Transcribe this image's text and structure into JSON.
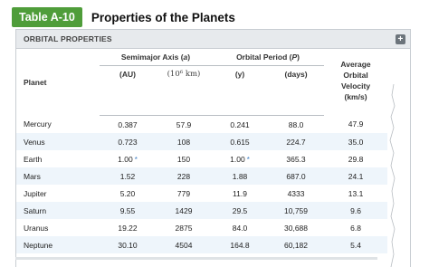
{
  "header": {
    "badge": "Table A-10",
    "title": "Properties of the Planets"
  },
  "section": {
    "label": "ORBITAL PROPERTIES",
    "expand_icon": "plus-icon"
  },
  "columns": {
    "planet": "Planet",
    "semimajor_group": "Semimajor Axis (a)",
    "period_group": "Orbital Period (P)",
    "au": "(AU)",
    "km": "(10⁶ km)",
    "yr": "(y)",
    "days": "(days)",
    "velocity": [
      "Average",
      "Orbital",
      "Velocity",
      "(km/s)"
    ]
  },
  "star_symbol": "*",
  "rows": [
    {
      "planet": "Mercury",
      "au": "0.387",
      "km": "57.9",
      "yr": "0.241",
      "days": "88.0",
      "vel": "47.9",
      "star_au": false,
      "star_yr": false
    },
    {
      "planet": "Venus",
      "au": "0.723",
      "km": "108",
      "yr": "0.615",
      "days": "224.7",
      "vel": "35.0",
      "star_au": false,
      "star_yr": false
    },
    {
      "planet": "Earth",
      "au": "1.00",
      "km": "150",
      "yr": "1.00",
      "days": "365.3",
      "vel": "29.8",
      "star_au": true,
      "star_yr": true
    },
    {
      "planet": "Mars",
      "au": "1.52",
      "km": "228",
      "yr": "1.88",
      "days": "687.0",
      "vel": "24.1",
      "star_au": false,
      "star_yr": false
    },
    {
      "planet": "Jupiter",
      "au": "5.20",
      "km": "779",
      "yr": "11.9",
      "days": "4333",
      "vel": "13.1",
      "star_au": false,
      "star_yr": false
    },
    {
      "planet": "Saturn",
      "au": "9.55",
      "km": "1429",
      "yr": "29.5",
      "days": "10,759",
      "vel": "9.6",
      "star_au": false,
      "star_yr": false
    },
    {
      "planet": "Uranus",
      "au": "19.22",
      "km": "2875",
      "yr": "84.0",
      "days": "30,688",
      "vel": "6.8",
      "star_au": false,
      "star_yr": false
    },
    {
      "planet": "Neptune",
      "au": "30.10",
      "km": "4504",
      "yr": "164.8",
      "days": "60,182",
      "vel": "5.4",
      "star_au": false,
      "star_yr": false
    }
  ],
  "colors": {
    "badge": "#4f9d3a",
    "stripe": "#eef5fb",
    "star": "#3f7fc4",
    "header_band": "#e7eaed"
  }
}
